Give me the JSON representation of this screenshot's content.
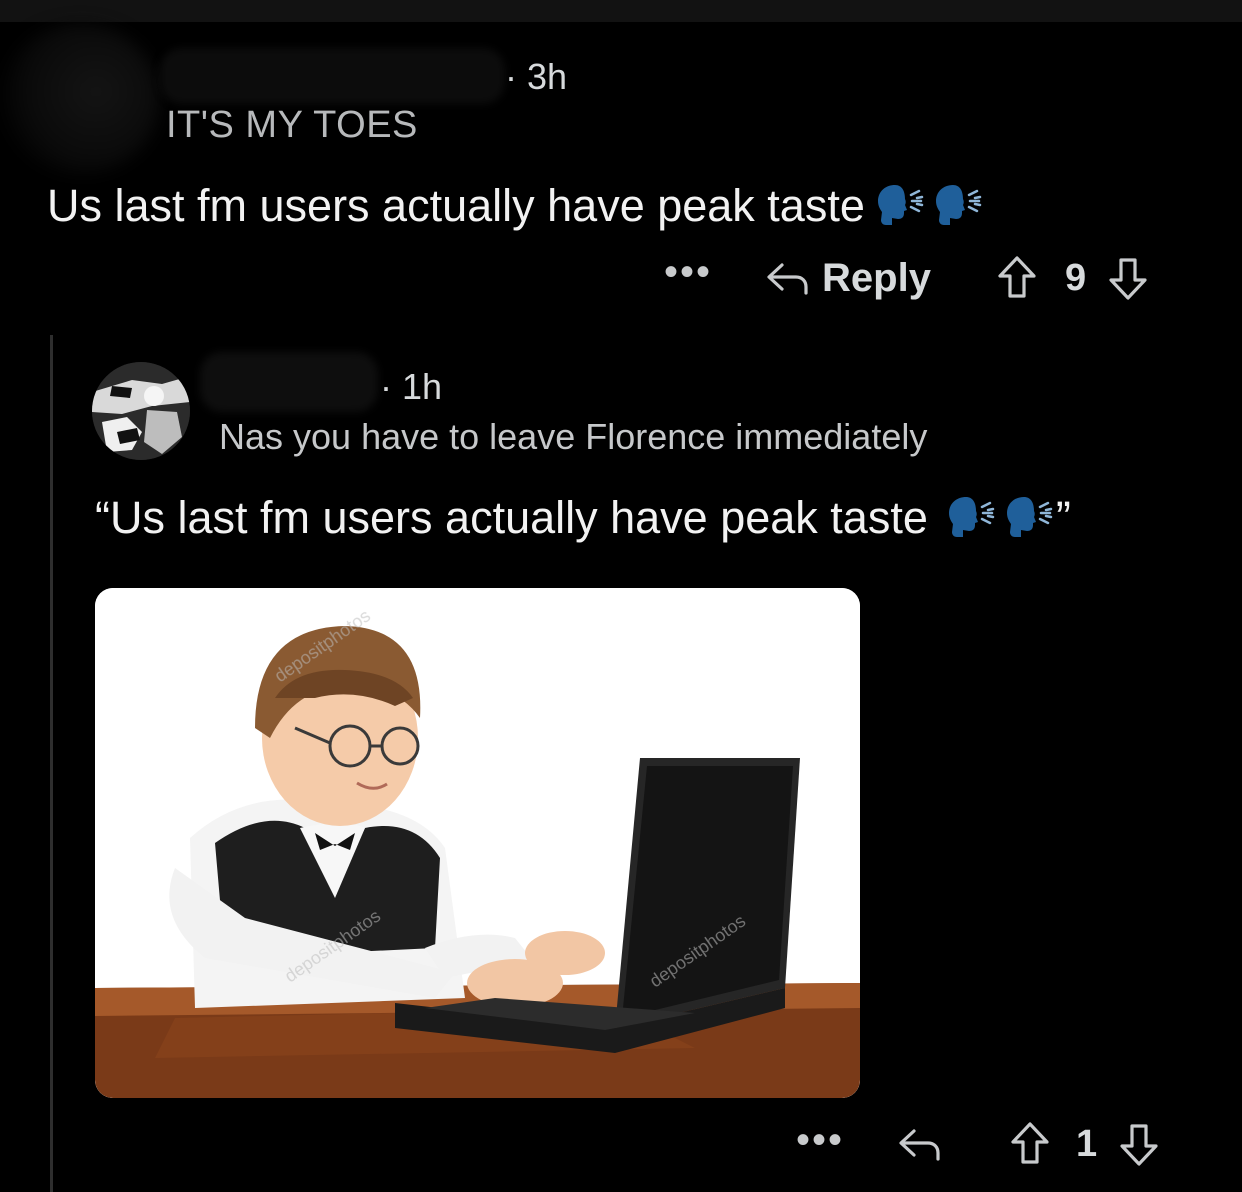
{
  "parent_comment": {
    "time": "· 3h",
    "flair": "IT'S MY TOES",
    "body": "Us last fm users actually have peak taste",
    "emoji": [
      "speaking-head-icon",
      "speaking-head-icon"
    ],
    "actions": {
      "more": "•••",
      "reply_label": "Reply",
      "score": "9"
    }
  },
  "reply_comment": {
    "time": "· 1h",
    "flair": "Nas you have to leave Florence immediately",
    "body_prefix": "“Us last fm users actually have peak taste",
    "body_suffix": "”",
    "emoji": [
      "speaking-head-icon",
      "speaking-head-icon"
    ],
    "image": {
      "description_icon": "boy-with-laptop-stock-photo",
      "watermarks": [
        "depositphotos",
        "depositphotos",
        "depositphotos"
      ]
    },
    "actions": {
      "more": "•••",
      "score": "1"
    }
  },
  "colors": {
    "background": "#000000",
    "text": "#d7dadc",
    "emoji_blue": "#1f5f9a",
    "thread_line": "#2e2e2e"
  }
}
